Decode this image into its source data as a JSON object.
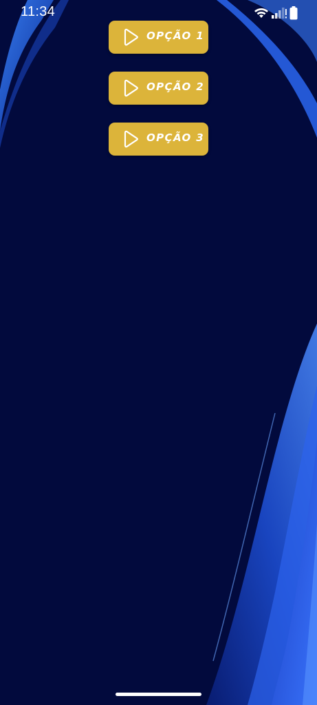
{
  "status_bar": {
    "time": "11:34",
    "icons": [
      "wifi-icon",
      "signal-icon",
      "battery-icon"
    ]
  },
  "options": [
    {
      "label": "OPÇÃO 1",
      "icon": "play-icon"
    },
    {
      "label": "OPÇÃO 2",
      "icon": "play-icon"
    },
    {
      "label": "OPÇÃO 3",
      "icon": "play-icon"
    }
  ],
  "colors": {
    "background": "#020a3d",
    "button": "#dcb43a",
    "button_text": "#ffffff",
    "accent_blue": "#2f6fe0"
  }
}
